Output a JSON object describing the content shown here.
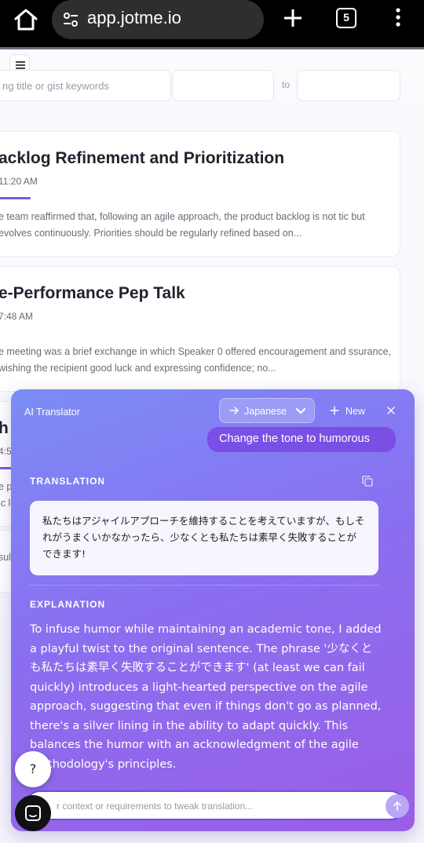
{
  "browser": {
    "url": "app.jotme.io",
    "tab_count": "5",
    "icons": [
      "home-icon",
      "site-settings-icon",
      "new-tab-icon",
      "tab-switcher-icon",
      "more-options-icon"
    ]
  },
  "filters": {
    "search_placeholder": "ng title or gist keywords",
    "to_label": "to"
  },
  "meetings": [
    {
      "title": "acklog Refinement and Prioritization",
      "time": "11:20 AM",
      "summary": "e team reaffirmed that, following an agile approach, the product backlog is not tic but evolves continuously. Priorities should be regularly refined based on..."
    },
    {
      "title": "e-Performance Pep Talk",
      "time": "7:48 AM",
      "summary": "e meeting was a brief exchange in which Speaker 0 offered encouragement and ssurance, wishing the recipient good luck and expressing confidence; no..."
    },
    {
      "title": "h",
      "time": "4:5",
      "summary": "e po ic lo"
    }
  ],
  "partial_text": "sul",
  "translator": {
    "title": "AI Translator",
    "language": "Japanese",
    "new_label": "New",
    "request_chip": "Change the tone to humorous",
    "translation_heading": "TRANSLATION",
    "translation_text": "私たちはアジャイルアプローチを維持することを考えていますが、もしそれがうまくいかなかったら、少なくとも私たちは素早く失敗することができます!",
    "explanation_heading": "EXPLANATION",
    "explanation_text": "To infuse humor while maintaining an academic tone, I added a playful twist to the original sentence. The phrase '少なくとも私たちは素早く失敗することができます' (at least we can fail quickly) introduces a light-hearted perspective on the agile approach, suggesting that even if things don't go as planned, there's a silver lining in the ability to adapt quickly. This balances the humor with an acknowledgment of the agile methodology's principles.",
    "input_placeholder": "r context or requirements to tweak translation..."
  },
  "help_label": "?",
  "colors": {
    "accent": "#7b55e0",
    "panel_gradient_start": "#7b8df6",
    "panel_gradient_end": "#9a5ee6",
    "chip": "#7a4fe6"
  }
}
